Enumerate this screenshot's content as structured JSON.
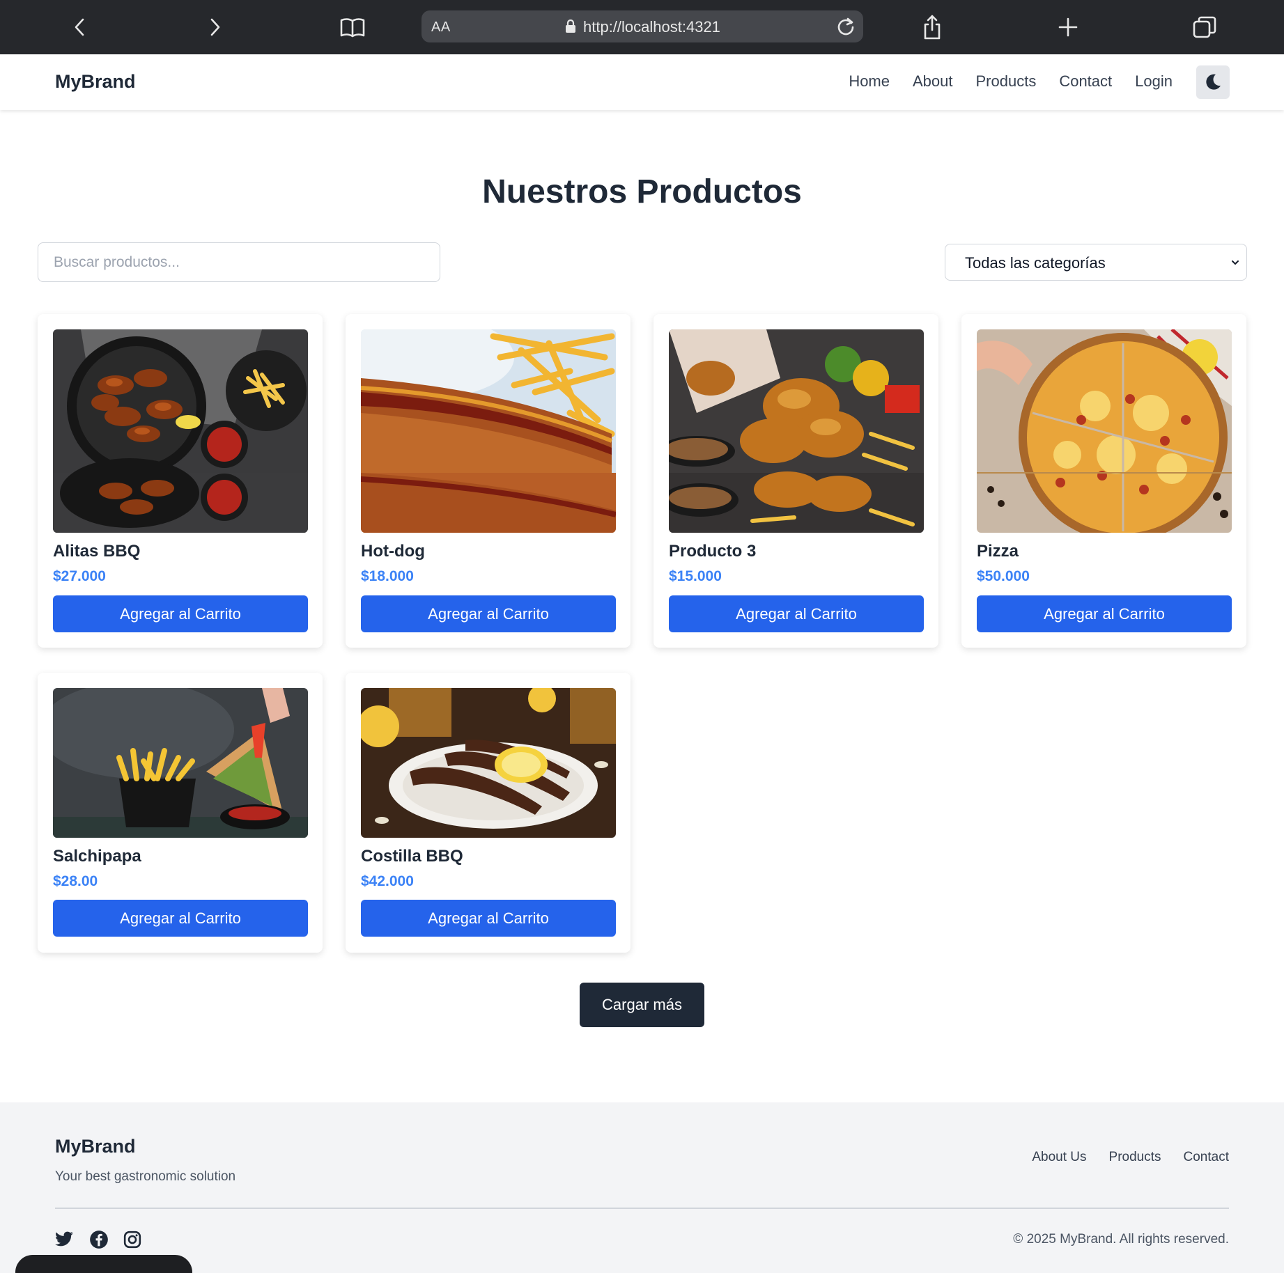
{
  "browser": {
    "text_size_label": "AA",
    "url": "http://localhost:4321"
  },
  "nav": {
    "brand": "MyBrand",
    "links": [
      "Home",
      "About",
      "Products",
      "Contact",
      "Login"
    ],
    "theme_icon": "moon-icon"
  },
  "main": {
    "title": "Nuestros Productos",
    "search_placeholder": "Buscar productos...",
    "category_selected": "Todas las categorías",
    "load_more_label": "Cargar más"
  },
  "products": [
    {
      "name": "Alitas BBQ",
      "price": "$27.000",
      "button": "Agregar al Carrito",
      "image": "bbq-wings-photo"
    },
    {
      "name": "Hot-dog",
      "price": "$18.000",
      "button": "Agregar al Carrito",
      "image": "hot-dog-photo"
    },
    {
      "name": "Producto 3",
      "price": "$15.000",
      "button": "Agregar al Carrito",
      "image": "fried-chicken-photo"
    },
    {
      "name": "Pizza",
      "price": "$50.000",
      "button": "Agregar al Carrito",
      "image": "pizza-photo"
    },
    {
      "name": "Salchipapa",
      "price": "$28.00",
      "button": "Agregar al Carrito",
      "image": "fries-photo"
    },
    {
      "name": "Costilla BBQ",
      "price": "$42.000",
      "button": "Agregar al Carrito",
      "image": "bbq-ribs-photo"
    }
  ],
  "footer": {
    "brand": "MyBrand",
    "tagline": "Your best gastronomic solution",
    "links": [
      "About Us",
      "Products",
      "Contact"
    ],
    "copyright": "© 2025 MyBrand. All rights reserved.",
    "social": [
      "twitter-icon",
      "facebook-icon",
      "instagram-icon"
    ]
  },
  "colors": {
    "accent": "#2563eb",
    "price": "#3b82f6",
    "dark_button": "#1f2937",
    "chrome": "#26282c"
  }
}
